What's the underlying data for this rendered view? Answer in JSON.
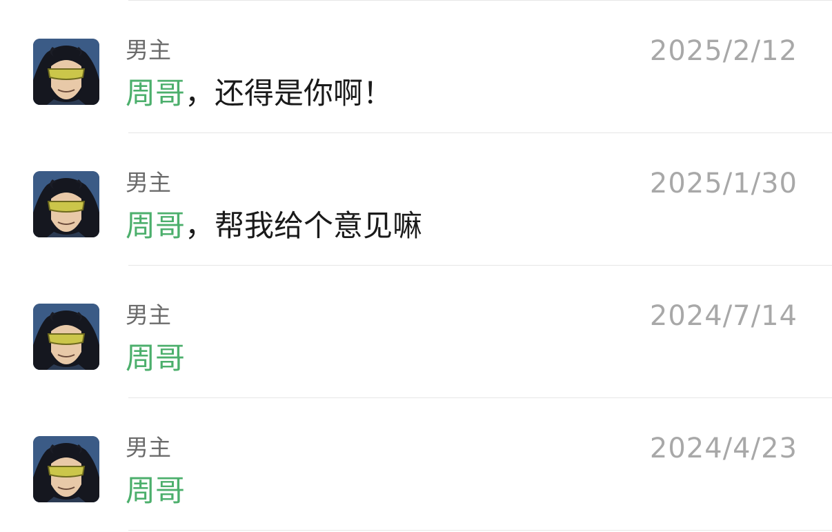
{
  "colors": {
    "mention": "#4caf6c",
    "sender": "#6b6b6b",
    "date": "#a8a8a8",
    "message": "#1a1a1a",
    "divider": "#e6e6e6"
  },
  "items": [
    {
      "avatar_icon": "man-with-yellow-glasses-avatar",
      "sender": "男主",
      "date": "2025/2/12",
      "mention": "周哥",
      "text": "，还得是你啊！"
    },
    {
      "avatar_icon": "man-with-yellow-glasses-avatar",
      "sender": "男主",
      "date": "2025/1/30",
      "mention": "周哥",
      "text": "，帮我给个意见嘛"
    },
    {
      "avatar_icon": "man-with-yellow-glasses-avatar",
      "sender": "男主",
      "date": "2024/7/14",
      "mention": "周哥",
      "text": ""
    },
    {
      "avatar_icon": "man-with-yellow-glasses-avatar",
      "sender": "男主",
      "date": "2024/4/23",
      "mention": "周哥",
      "text": ""
    }
  ]
}
